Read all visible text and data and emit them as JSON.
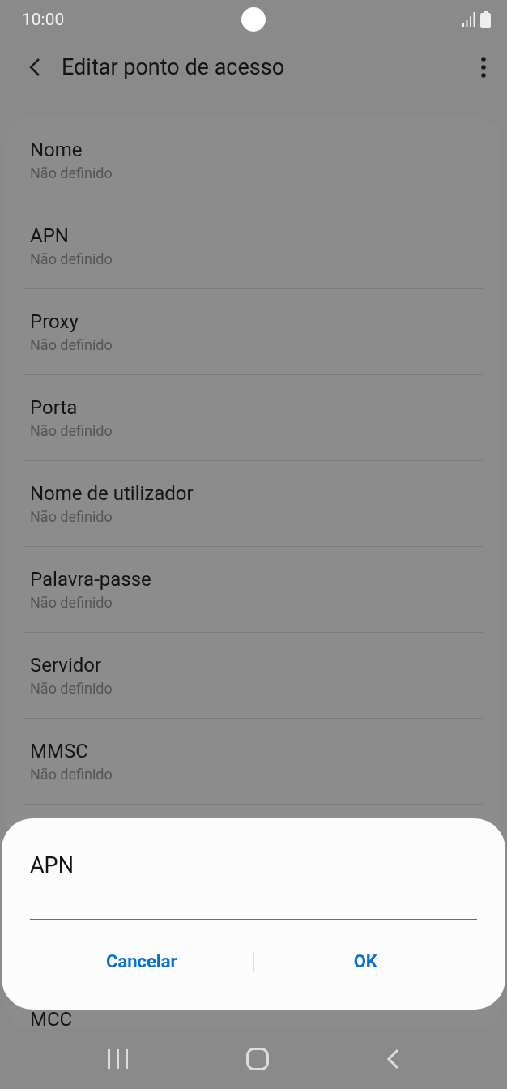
{
  "status_bar": {
    "time": "10:00"
  },
  "header": {
    "title": "Editar ponto de acesso"
  },
  "settings": [
    {
      "title": "Nome",
      "value": "Não definido"
    },
    {
      "title": "APN",
      "value": "Não definido"
    },
    {
      "title": "Proxy",
      "value": "Não definido"
    },
    {
      "title": "Porta",
      "value": "Não definido"
    },
    {
      "title": "Nome de utilizador",
      "value": "Não definido"
    },
    {
      "title": "Palavra-passe",
      "value": "Não definido"
    },
    {
      "title": "Servidor",
      "value": "Não definido"
    },
    {
      "title": "MMSC",
      "value": "Não definido"
    }
  ],
  "partial_setting": {
    "title": "MCC"
  },
  "dialog": {
    "title": "APN",
    "buttons": [
      "Cancelar",
      "OK"
    ]
  }
}
